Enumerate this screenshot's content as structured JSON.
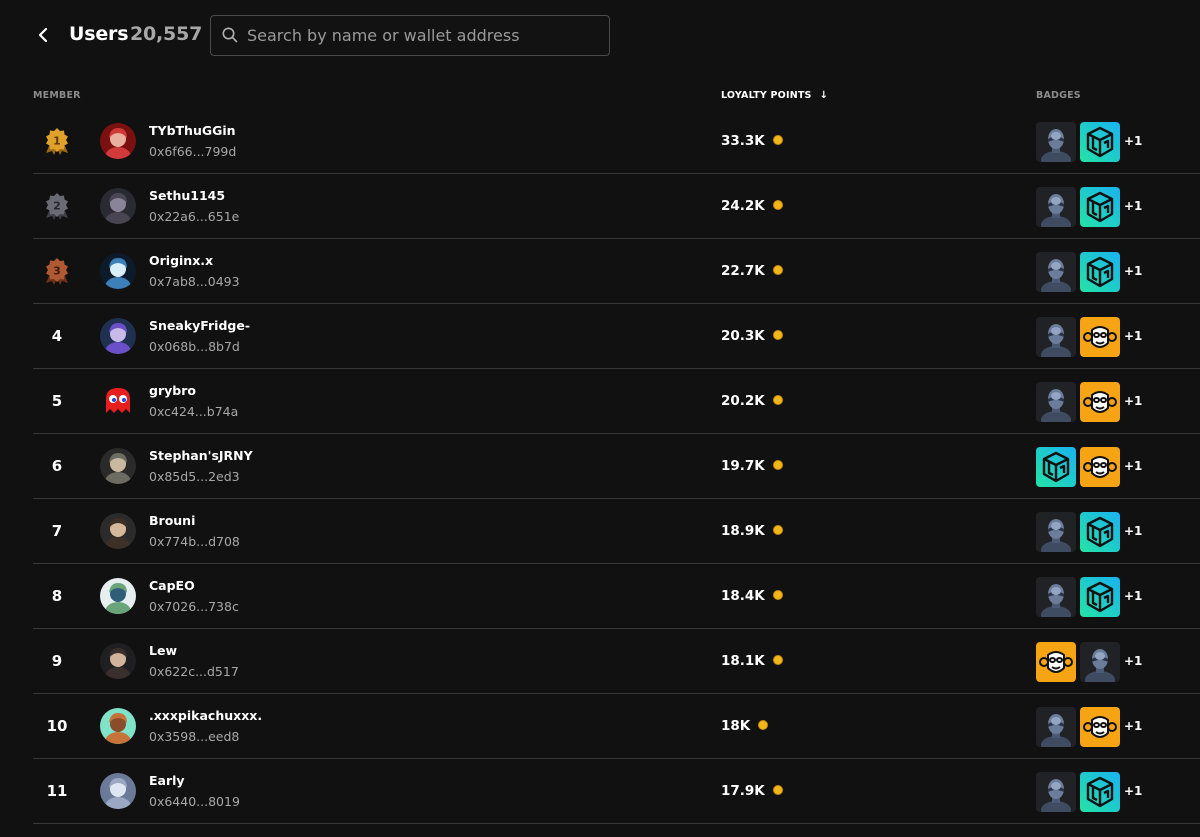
{
  "header": {
    "title": "Users",
    "count": "20,557",
    "search_placeholder": "Search by name or wallet address",
    "search_value": ""
  },
  "columns": {
    "member": "MEMBER",
    "points": "LOYALTY POINTS",
    "badges": "BADGES"
  },
  "colors": {
    "background": "#111111",
    "gold": "#e0a02c",
    "silver": "#6b6b75",
    "bronze": "#b05a33",
    "coin": "#f3b619"
  },
  "users": [
    {
      "rank": "1",
      "medal": "gold",
      "name": "TYbThuGGin",
      "wallet": "0x6f66...799d",
      "points": "33.3K",
      "avatar": "red-robot",
      "badges": [
        "robot-badge",
        "cube-badge"
      ],
      "more": "+1"
    },
    {
      "rank": "2",
      "medal": "silver",
      "name": "Sethu1145",
      "wallet": "0x22a6...651e",
      "points": "24.2K",
      "avatar": "dark-hooded",
      "badges": [
        "robot-badge",
        "cube-badge"
      ],
      "more": "+1"
    },
    {
      "rank": "3",
      "medal": "bronze",
      "name": "Originx.x",
      "wallet": "0x7ab8...0493",
      "points": "22.7K",
      "avatar": "blue-swirl",
      "badges": [
        "robot-badge",
        "cube-badge"
      ],
      "more": "+1"
    },
    {
      "rank": "4",
      "medal": "",
      "name": "SneakyFridge-",
      "wallet": "0x068b...8b7d",
      "points": "20.3K",
      "avatar": "purple-hair",
      "badges": [
        "robot-badge",
        "monkey-badge"
      ],
      "more": "+1"
    },
    {
      "rank": "5",
      "medal": "",
      "name": "grybro",
      "wallet": "0xc424...b74a",
      "points": "20.2K",
      "avatar": "red-ghost",
      "badges": [
        "robot-badge",
        "monkey-badge"
      ],
      "more": "+1"
    },
    {
      "rank": "6",
      "medal": "",
      "name": "Stephan'sJRNY",
      "wallet": "0x85d5...2ed3",
      "points": "19.7K",
      "avatar": "grey-soldier",
      "badges": [
        "cube-badge",
        "monkey-badge"
      ],
      "more": "+1"
    },
    {
      "rank": "7",
      "medal": "",
      "name": "Brouni",
      "wallet": "0x774b...d708",
      "points": "18.9K",
      "avatar": "suit-man",
      "badges": [
        "robot-badge",
        "cube-badge"
      ],
      "more": "+1"
    },
    {
      "rank": "8",
      "medal": "",
      "name": "CapEO",
      "wallet": "0x7026...738c",
      "points": "18.4K",
      "avatar": "green-cap",
      "badges": [
        "robot-badge",
        "cube-badge"
      ],
      "more": "+1"
    },
    {
      "rank": "9",
      "medal": "",
      "name": "Lew",
      "wallet": "0x622c...d517",
      "points": "18.1K",
      "avatar": "dark-hair",
      "badges": [
        "monkey-badge",
        "robot-badge"
      ],
      "more": "+1"
    },
    {
      "rank": "10",
      "medal": "",
      "name": ".xxxpikachuxxx.",
      "wallet": "0x3598...eed8",
      "points": "18K",
      "avatar": "teal-character",
      "badges": [
        "robot-badge",
        "monkey-badge"
      ],
      "more": "+1"
    },
    {
      "rank": "11",
      "medal": "",
      "name": "Early",
      "wallet": "0x6440...8019",
      "points": "17.9K",
      "avatar": "blue-armor",
      "badges": [
        "robot-badge",
        "cube-badge"
      ],
      "more": "+1"
    }
  ]
}
